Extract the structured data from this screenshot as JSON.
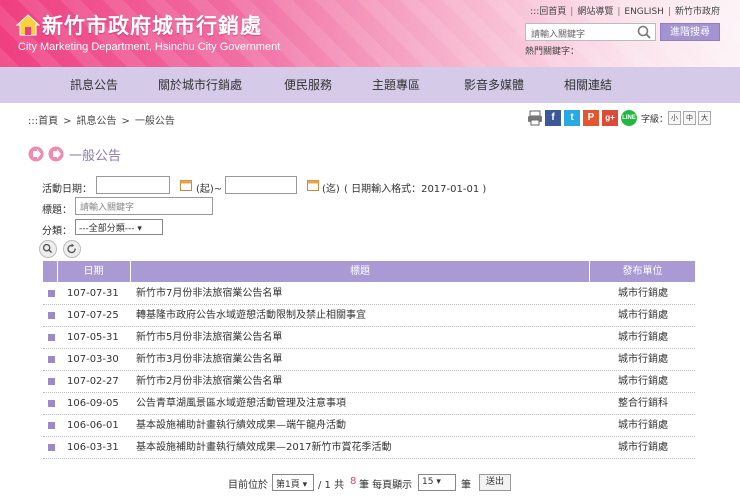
{
  "header": {
    "title": "新竹市政府城市行銷處",
    "subtitle": "City Marketing Department, Hsinchu City Government",
    "toplinks": [
      ":::回首頁",
      "網站導覽",
      "ENGLISH",
      "新竹市政府"
    ],
    "search_placeholder": "請輸入關鍵字",
    "advanced_search": "進階搜尋",
    "hot_keywords_label": "熱門關鍵字："
  },
  "nav": {
    "items": [
      "訊息公告",
      "關於城市行銷處",
      "便民服務",
      "主題專區",
      "影音多媒體",
      "相關連結"
    ]
  },
  "breadcrumb": [
    ":::首頁",
    "訊息公告",
    "一般公告"
  ],
  "breadcrumb_sep": ">",
  "share": {
    "icons": [
      "print-icon",
      "facebook-icon",
      "twitter-icon",
      "plurk-icon",
      "googleplus-icon",
      "line-icon"
    ],
    "font_size_label": "字級：",
    "font_sizes": [
      "小",
      "中",
      "大"
    ]
  },
  "page": {
    "title": "一般公告"
  },
  "filter": {
    "date_label": "活動日期：",
    "from_label": "(起)~",
    "to_label": "(迄)",
    "format_hint": "( 日期輸入格式：2017-01-01 )",
    "keyword_label": "標題：",
    "keyword_placeholder": "請輸入關鍵字",
    "category_label": "分類：",
    "category_value": "---全部分類---"
  },
  "table": {
    "headers": [
      "日期",
      "標題",
      "發布單位"
    ],
    "rows": [
      {
        "date": "107-07-31",
        "title": "新竹市7月份非法旅宿業公告名單",
        "unit": "城市行銷處"
      },
      {
        "date": "107-07-25",
        "title": "轉基隆市政府公告水域遊憩活動限制及禁止相關事宜",
        "unit": "城市行銷處"
      },
      {
        "date": "107-05-31",
        "title": "新竹市5月份非法旅宿業公告名單",
        "unit": "城市行銷處"
      },
      {
        "date": "107-03-30",
        "title": "新竹市3月份非法旅宿業公告名單",
        "unit": "城市行銷處"
      },
      {
        "date": "107-02-27",
        "title": "新竹市2月份非法旅宿業公告名單",
        "unit": "城市行銷處"
      },
      {
        "date": "106-09-05",
        "title": "公告青草湖風景區水域遊憩活動管理及注意事項",
        "unit": "整合行銷科"
      },
      {
        "date": "106-06-01",
        "title": "基本設施補助計畫執行績效成果—端午龍舟活動",
        "unit": "城市行銷處"
      },
      {
        "date": "106-03-31",
        "title": "基本設施補助計畫執行績效成果—2017新竹市賞花季活動",
        "unit": "城市行銷處"
      }
    ]
  },
  "pager": {
    "current_label": "目前位於",
    "page_value": "第1頁",
    "of_label": "/ 1 共",
    "total": "8",
    "records_label": "筆 每頁顯示",
    "per_page": "15",
    "unit_label": "筆",
    "send": "送出"
  },
  "colors": {
    "header_pink": "#ef3f80",
    "nav_lilac": "#d5cbe8",
    "table_header": "#a99ad3",
    "accent_red": "#e2447a"
  }
}
